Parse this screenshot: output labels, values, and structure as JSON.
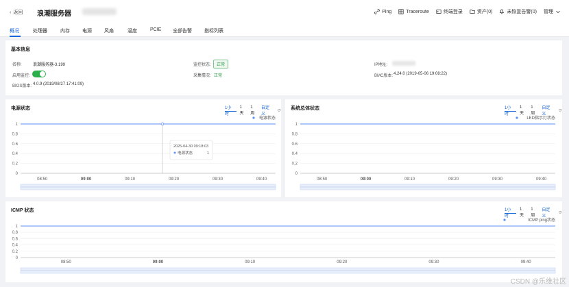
{
  "topbar": {
    "back": "返回",
    "title": "浪潮服务器",
    "actions": [
      {
        "label": "Ping",
        "icon": "link-icon"
      },
      {
        "label": "Traceroute",
        "icon": "grid-icon"
      },
      {
        "label": "终端登录",
        "icon": "terminal-icon"
      },
      {
        "label": "资产(0)",
        "icon": "folder-icon"
      },
      {
        "label": "未恢复告警(0)",
        "icon": "bell-icon"
      },
      {
        "label": "管理",
        "icon": "chevron-down-icon"
      }
    ]
  },
  "tabs": [
    "概况",
    "处理器",
    "内存",
    "电源",
    "风扇",
    "温度",
    "PCIE",
    "全部告警",
    "指标列表"
  ],
  "basic_info": {
    "title": "基本信息",
    "name_label": "名称:",
    "name_value": "浪潮服务器-3.199",
    "monitor_enabled_label": "启用监控:",
    "bios_label": "BIOS版本:",
    "bios_value": "4.0.9 (2019/08/27 17:41:09)",
    "monitor_status_label": "监控状态:",
    "monitor_status_value": "正常",
    "collect_label": "采集情况:",
    "collect_value": "正常",
    "ip_label": "IP地址:",
    "bmc_label": "BMC版本:",
    "bmc_value": "4.24.0 (2019-05-06 19:08:22)"
  },
  "range": {
    "h1": "1小时",
    "d1": "1天",
    "w1": "1周",
    "custom": "自定义"
  },
  "colors": {
    "accent": "#1565d8",
    "line": "#5b8ff9",
    "ok": "#2e9a4a"
  },
  "tooltip": {
    "time": "2025-04-30 09:18:03",
    "label": "电源状态",
    "value": "1"
  },
  "chart_data": [
    {
      "type": "line",
      "title": "电源状态",
      "x": [
        "08:50",
        "09:00",
        "09:10",
        "09:20",
        "09:30",
        "09:40"
      ],
      "series": [
        {
          "name": "电源状态",
          "values": [
            1,
            1,
            1,
            1,
            1,
            1
          ]
        }
      ],
      "yticks": [
        "0",
        "0.2",
        "0.4",
        "0.6",
        "0.8",
        "1"
      ],
      "ylim": [
        0,
        1
      ]
    },
    {
      "type": "line",
      "title": "系统总体状态",
      "x": [
        "08:50",
        "09:00",
        "09:10",
        "09:20",
        "09:30",
        "09:40"
      ],
      "series": [
        {
          "name": "LED指示灯状态",
          "values": [
            1,
            1,
            1,
            1,
            1,
            1
          ]
        }
      ],
      "yticks": [
        "0",
        "0.2",
        "0.4",
        "0.6",
        "0.8",
        "1"
      ],
      "ylim": [
        0,
        1
      ]
    },
    {
      "type": "line",
      "title": "ICMP 状态",
      "x": [
        "08:50",
        "09:00",
        "09:10",
        "09:20",
        "09:30",
        "09:40"
      ],
      "series": [
        {
          "name": "ICMP ping状态",
          "values": [
            1,
            1,
            1,
            1,
            1,
            1
          ]
        }
      ],
      "yticks": [
        "0",
        "0.2",
        "0.4",
        "0.6",
        "0.8",
        "1"
      ],
      "ylim": [
        0,
        1
      ]
    }
  ],
  "watermark": "CSDN @乐维社区"
}
